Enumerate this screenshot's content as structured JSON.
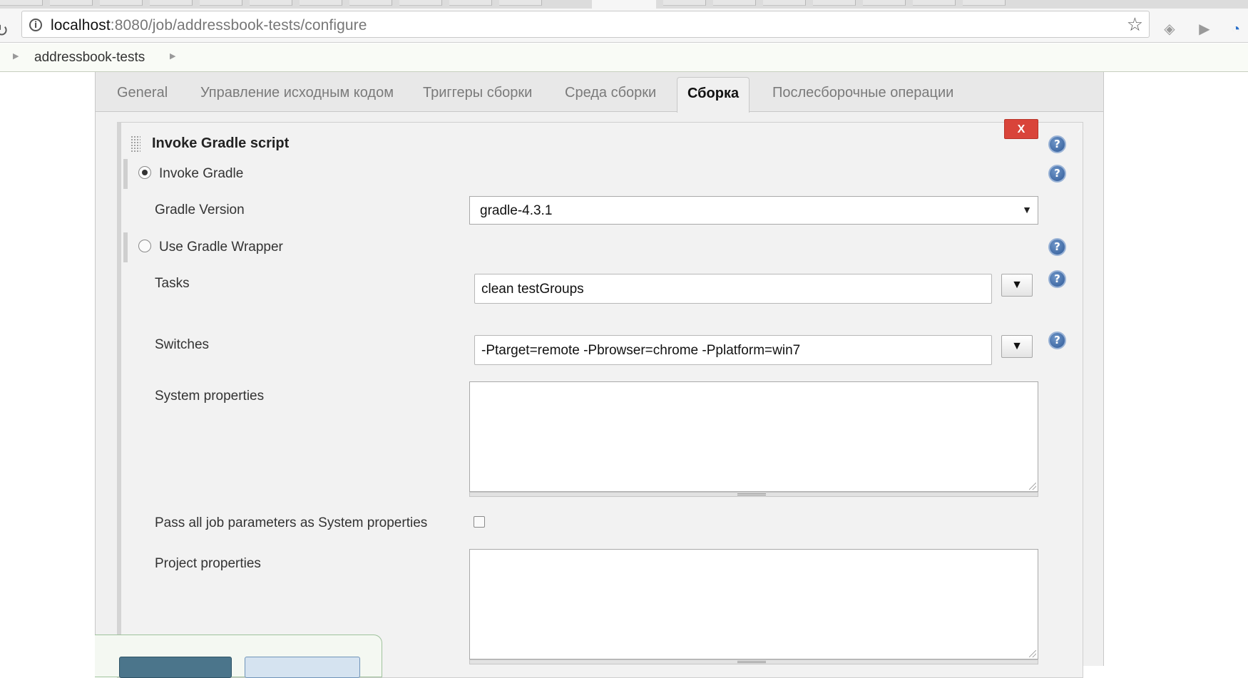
{
  "browser": {
    "url_host": "localhost",
    "url_path": ":8080/job/addressbook-tests/configure"
  },
  "breadcrumb": {
    "items": [
      "addressbook-tests"
    ]
  },
  "tabs": [
    {
      "label": "General"
    },
    {
      "label": "Управление исходным кодом"
    },
    {
      "label": "Триггеры сборки"
    },
    {
      "label": "Среда сборки"
    },
    {
      "label": "Сборка",
      "active": true
    },
    {
      "label": "Послесборочные операции"
    }
  ],
  "build_step": {
    "title": "Invoke Gradle script",
    "delete_label": "X",
    "invoke_gradle_label": "Invoke Gradle",
    "gradle_version_label": "Gradle Version",
    "gradle_version_value": "gradle-4.3.1",
    "use_wrapper_label": "Use Gradle Wrapper",
    "tasks_label": "Tasks",
    "tasks_value": "clean testGroups",
    "switches_label": "Switches",
    "switches_value": "-Ptarget=remote -Pbrowser=chrome -Pplatform=win7",
    "system_properties_label": "System properties",
    "pass_params_label": "Pass all job parameters as System properties",
    "project_properties_label": "Project properties",
    "help_glyph": "?",
    "dropdown_glyph": "▼"
  },
  "colors": {
    "delete_button": "#d9443a",
    "help_icon": "#2f5a98",
    "save_button": "#4b758b"
  }
}
